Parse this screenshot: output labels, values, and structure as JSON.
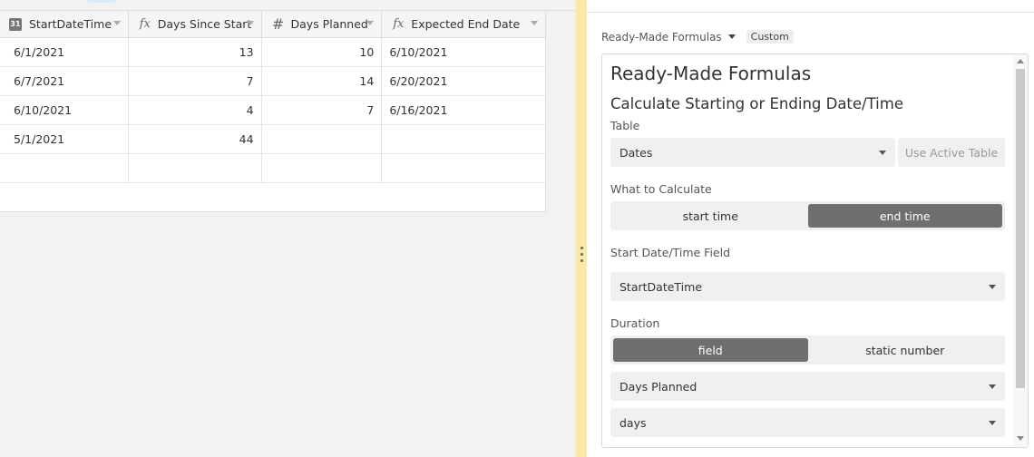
{
  "grid": {
    "columns": [
      {
        "label": "StartDateTime",
        "icon": "calendar-icon",
        "icon_text": "31"
      },
      {
        "label": "Days Since Start",
        "icon": "formula-icon",
        "icon_text": "fx"
      },
      {
        "label": "Days Planned",
        "icon": "number-icon",
        "icon_text": "#"
      },
      {
        "label": "Expected End Date",
        "icon": "formula-icon",
        "icon_text": "fx"
      }
    ],
    "rows": [
      {
        "start": "6/1/2021",
        "since": "13",
        "planned": "10",
        "end": "6/10/2021"
      },
      {
        "start": "6/7/2021",
        "since": "7",
        "planned": "14",
        "end": "6/20/2021"
      },
      {
        "start": "6/10/2021",
        "since": "4",
        "planned": "7",
        "end": "6/16/2021"
      },
      {
        "start": "5/1/2021",
        "since": "44",
        "planned": "",
        "end": ""
      }
    ]
  },
  "panel": {
    "picker_label": "Ready-Made Formulas",
    "picker_badge": "Custom",
    "title": "Ready-Made Formulas",
    "subtitle": "Calculate Starting or Ending Date/Time",
    "table_label": "Table",
    "table_value": "Dates",
    "use_active_table": "Use Active Table",
    "calc_label": "What to Calculate",
    "calc_options": [
      "start time",
      "end time"
    ],
    "calc_selected": "end time",
    "start_field_label": "Start Date/Time Field",
    "start_field_value": "StartDateTime",
    "duration_label": "Duration",
    "duration_options": [
      "field",
      "static number"
    ],
    "duration_selected": "field",
    "duration_field_value": "Days Planned",
    "unit_value": "days"
  },
  "colors": {
    "divider": "#fbe7a6",
    "segment_selected": "#6f6f6f"
  }
}
